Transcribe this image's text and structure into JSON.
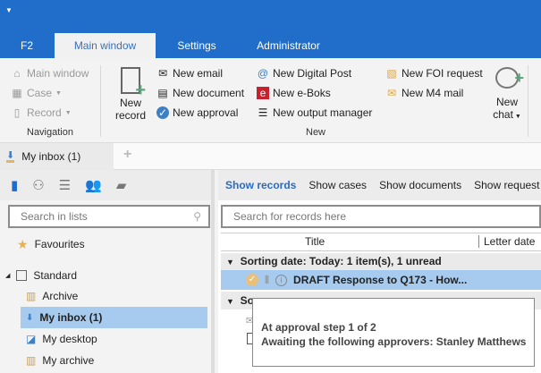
{
  "colors": {
    "accent": "#206dca",
    "selection": "#a7cbee"
  },
  "quick_access_icon": "dropdown-arrow-icon",
  "tabs": [
    {
      "label": "F2"
    },
    {
      "label": "Main window",
      "active": true
    },
    {
      "label": "Settings"
    },
    {
      "label": "Administrator"
    }
  ],
  "ribbon": {
    "navigation": {
      "label": "Navigation",
      "items": [
        {
          "label": "Main window",
          "icon": "home-icon"
        },
        {
          "label": "Case",
          "icon": "case-icon"
        },
        {
          "label": "Record",
          "icon": "record-icon"
        }
      ]
    },
    "new": {
      "label": "New",
      "new_record": [
        "New",
        "record"
      ],
      "items": [
        {
          "label": "New email",
          "icon": "email-icon"
        },
        {
          "label": "New document",
          "icon": "document-icon"
        },
        {
          "label": "New approval",
          "icon": "approval-icon"
        },
        {
          "label": "New Digital Post",
          "icon": "digital-post-icon"
        },
        {
          "label": "New e-Boks",
          "icon": "eboks-icon"
        },
        {
          "label": "New output manager",
          "icon": "output-manager-icon"
        },
        {
          "label": "New FOI request",
          "icon": "foi-icon"
        },
        {
          "label": "New M4 mail",
          "icon": "m4-mail-icon"
        }
      ],
      "new_chat": [
        "New",
        "chat"
      ]
    }
  },
  "doc_tab": {
    "label": "My inbox (1)",
    "add": "+"
  },
  "left": {
    "search_placeholder": "Search in lists",
    "favourites": "Favourites",
    "standard": "Standard",
    "items": [
      {
        "label": "Archive"
      },
      {
        "label": "My inbox (1)",
        "selected": true
      },
      {
        "label": "My desktop"
      },
      {
        "label": "My archive"
      }
    ]
  },
  "right": {
    "show": [
      "Show records",
      "Show cases",
      "Show documents",
      "Show request"
    ],
    "search_placeholder": "Search for records here",
    "columns": [
      "Title",
      "Letter date"
    ],
    "group1": "Sorting date: Today: 1 item(s), 1 unread",
    "row1": "DRAFT Response to Q173 - How...",
    "group2": "So",
    "tooltip": [
      "At approval step 1 of 2",
      "Awaiting the following approvers: Stanley Matthews"
    ]
  }
}
